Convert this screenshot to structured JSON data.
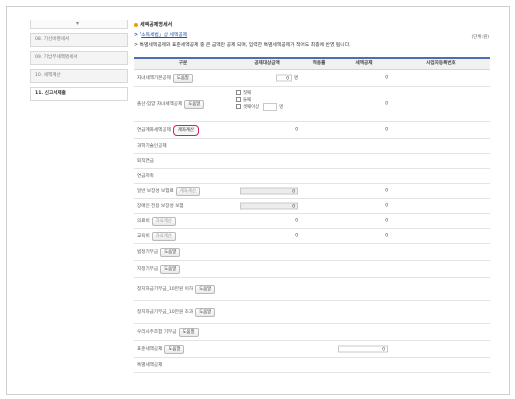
{
  "sidebar": {
    "items": [
      {
        "label": "08. 기신비명세서",
        "active": false
      },
      {
        "label": "09. 기납부세액명세서",
        "active": false
      },
      {
        "label": "10. 세액계산",
        "active": false
      },
      {
        "label": "11. 신고서제출",
        "active": true
      }
    ]
  },
  "header": {
    "title": "세액공제명세서",
    "line1_prefix": "> '",
    "line1_link": "소득세법」상 세액공제",
    "line2": "> 특별세액공제와 표준세액공제 중 큰 금액만 공제 되며, 입력한 특별세액공제가 적어도 최종에 반영 됩니다.",
    "unit": "(단위:원)"
  },
  "table": {
    "headers": [
      "구분",
      "공제대상금액",
      "적용률",
      "세액공제",
      "사업자등록번호"
    ],
    "rows": [
      {
        "label": "자녀세액기본공제",
        "button": "도움말",
        "value": "0",
        "suffix": "명",
        "credit": "0"
      },
      {
        "label": "출산·입양 자녀세액공제",
        "button": "도움말",
        "checks": [
          "첫째",
          "둘째",
          "셋째이상"
        ],
        "check_suffix": "명",
        "credit": "0"
      },
      {
        "label": "연금계좌세액공제",
        "button": "계좌계산",
        "value": "0",
        "credit": "0"
      },
      {
        "label": "과학기술인공제"
      },
      {
        "label": "퇴직연금"
      },
      {
        "label": "연금저축"
      },
      {
        "label": "일반 보장성 보험료",
        "button": "계좌계산",
        "value": "0",
        "credit": "0"
      },
      {
        "label": "장애인 전용 보장성 보험",
        "button": "",
        "value": "0",
        "credit": "0"
      },
      {
        "label": "의료비",
        "button": "자료계산",
        "value": "0",
        "credit": "0"
      },
      {
        "label": "교육비",
        "button": "자료계산",
        "value": "0",
        "credit": "0"
      },
      {
        "label": "법정기부금",
        "button": "도움말"
      },
      {
        "label": "지정기부금",
        "button": "도움말"
      },
      {
        "label": "정치자금기부금_10만원 이하",
        "button": "도움말"
      },
      {
        "label": "정치자금기부금_10만원 초과",
        "button": "도움말"
      },
      {
        "label": "우리사주조합 기부금",
        "button": "도움말"
      },
      {
        "label": "표준세액공제",
        "button": "도움말",
        "credit": "0"
      },
      {
        "label": "특별세액공제"
      }
    ]
  },
  "colors": {
    "accent": "#4a6fb5",
    "highlight": "#d41e69",
    "title_dot": "#e8a000"
  },
  "icons": {
    "sidebar_toggle": "chevron-down-icon"
  }
}
